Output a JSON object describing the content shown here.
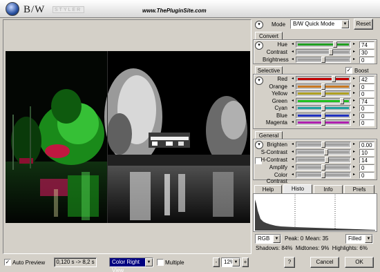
{
  "header": {
    "logo_text": "B/W",
    "logo_sub": "STYLER",
    "site_url": "www.ThePluginSite.com"
  },
  "mode": {
    "label": "Mode",
    "selected": "B/W Quick Mode",
    "reset_label": "Reset"
  },
  "convert": {
    "tab_label": "Convert",
    "sliders": [
      {
        "label": "Hue",
        "value": "74",
        "level": 0.74,
        "color": "#20a020"
      },
      {
        "label": "Contrast",
        "value": "30",
        "level": 0.65,
        "color": ""
      },
      {
        "label": "Brightness",
        "value": "0",
        "level": 0.5,
        "color": ""
      }
    ]
  },
  "selective": {
    "tab_label": "Selective",
    "boost_label": "Boost",
    "boost_checked": true,
    "sliders": [
      {
        "label": "Red",
        "value": "42",
        "level": 0.71,
        "color": "#c00000"
      },
      {
        "label": "Orange",
        "value": "0",
        "level": 0.5,
        "color": "#c87820"
      },
      {
        "label": "Yellow",
        "value": "0",
        "level": 0.5,
        "color": "#b0a020"
      },
      {
        "label": "Green",
        "value": "74",
        "level": 0.87,
        "color": "#20c020"
      },
      {
        "label": "Cyan",
        "value": "0",
        "level": 0.5,
        "color": "#20a0a0"
      },
      {
        "label": "Blue",
        "value": "0",
        "level": 0.5,
        "color": "#2030c0"
      },
      {
        "label": "Magenta",
        "value": "0",
        "level": 0.5,
        "color": "#b020b0"
      }
    ]
  },
  "general": {
    "tab_label": "General",
    "sliders": [
      {
        "label": "Brighten",
        "value": "0.00",
        "level": 0.5
      },
      {
        "label": "S-Contrast",
        "value": "10",
        "level": 0.55
      },
      {
        "label": "H-Contrast",
        "value": "14",
        "level": 0.57
      },
      {
        "label": "Amplify",
        "value": "0",
        "level": 0.5
      },
      {
        "label": "Color Contrast",
        "value": "0",
        "level": 0.5
      }
    ]
  },
  "info_tabs": [
    "Help",
    "Histo",
    "Info",
    "Prefs"
  ],
  "histogram": {
    "channel": "RGB",
    "peak_label": "Peak:",
    "peak_value": "0",
    "mean_label": "Mean:",
    "mean_value": "35",
    "display_mode": "Filled",
    "shadows_label": "Shadows:",
    "shadows_value": "84%",
    "midtones_label": "Midtones:",
    "midtones_value": "9%",
    "highlights_label": "Highlights:",
    "highlights_value": "6%"
  },
  "bottom": {
    "auto_preview_label": "Auto Preview",
    "auto_preview_checked": true,
    "timing": "0,120 s -> 8,2 s",
    "view_mode": "Color Right View",
    "multiple_label": "Multiple",
    "zoom_minus": "-",
    "zoom_value": "12%",
    "zoom_plus": "+",
    "help_label": "?",
    "cancel_label": "Cancel",
    "ok_label": "OK"
  },
  "colors": {
    "accent_blue": "#000080",
    "background": "#d4d0c8"
  }
}
